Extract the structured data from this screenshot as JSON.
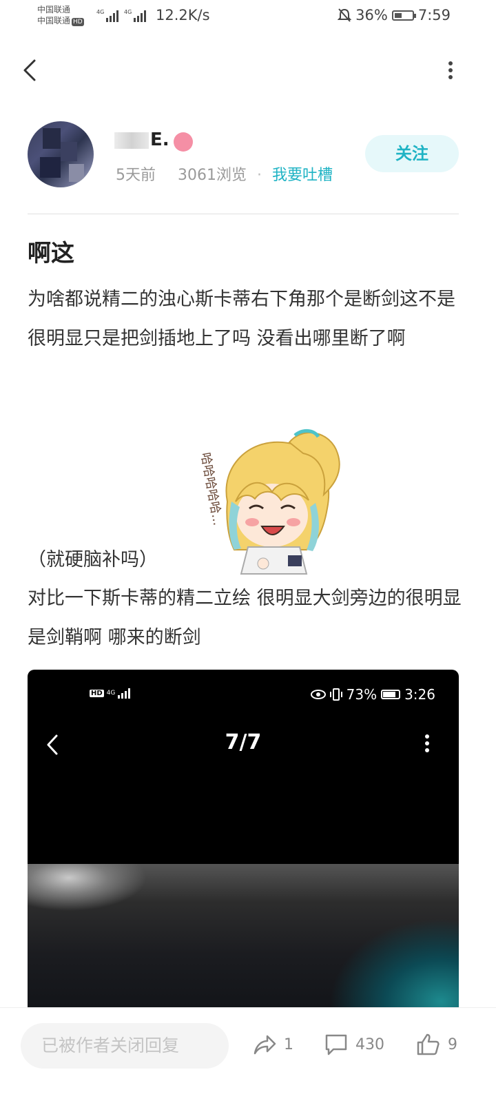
{
  "status_bar": {
    "carrier1": "中国联通",
    "carrier2": "中国联通",
    "hd": "HD",
    "net_speed": "12.2K/s",
    "battery_pct": "36%",
    "time": "7:59"
  },
  "author": {
    "name_visible": "E.",
    "time_ago": "5天前",
    "views": "3061浏览",
    "feedback_link": "我要吐槽",
    "follow_label": "关注"
  },
  "post": {
    "title": "啊这",
    "para1": "为啥都说精二的浊心斯卡蒂右下角那个是断剑这不是很明显只是把剑插地上了吗 没看出哪里断了啊",
    "para2": "（就硬脑补吗）",
    "para3": "对比一下斯卡蒂的精二立绘 很明显大剑旁边的很明显是剑鞘啊 哪来的断剑",
    "sticker_text": "哈哈哈哈哈..."
  },
  "embed": {
    "hd": "HD",
    "net": "4G",
    "battery_pct": "73%",
    "time": "3:26",
    "counter": "7/7"
  },
  "bottom": {
    "reply_placeholder": "已被作者关闭回复",
    "share_count": "1",
    "comment_count": "430",
    "like_count": "9"
  }
}
